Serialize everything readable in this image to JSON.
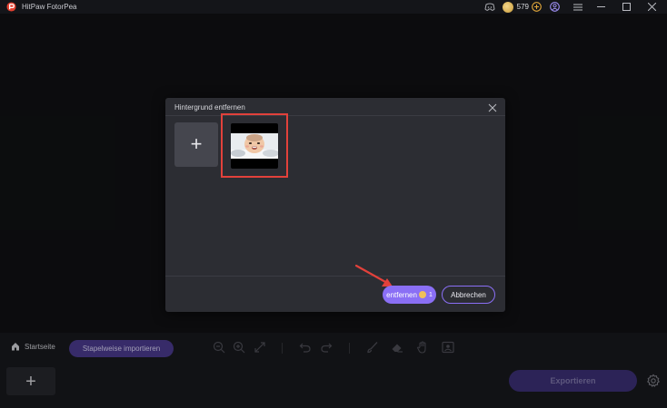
{
  "app": {
    "title": "HitPaw FotorPea",
    "credits": "579"
  },
  "dialog": {
    "title": "Hintergrund entfernen",
    "add_symbol": "+",
    "remove_label": "entfernen",
    "remove_cost": "1",
    "cancel_label": "Abbrechen"
  },
  "bottom": {
    "home_label": "Startseite",
    "batch_label": "Stapelweise importieren",
    "add_symbol": "+",
    "export_label": "Exportieren"
  },
  "colors": {
    "accent": "#8a6ff5",
    "highlight": "#e2413b",
    "background": "#111214"
  },
  "icons": [
    "app-logo-icon",
    "discord-icon",
    "coin-icon",
    "add-credits-icon",
    "account-icon",
    "menu-icon",
    "minimize-icon",
    "maximize-icon",
    "close-icon",
    "home-icon",
    "zoom-out-icon",
    "zoom-in-icon",
    "fit-screen-icon",
    "undo-icon",
    "redo-icon",
    "brush-icon",
    "eraser-icon",
    "hand-icon",
    "compare-icon",
    "settings-icon"
  ]
}
